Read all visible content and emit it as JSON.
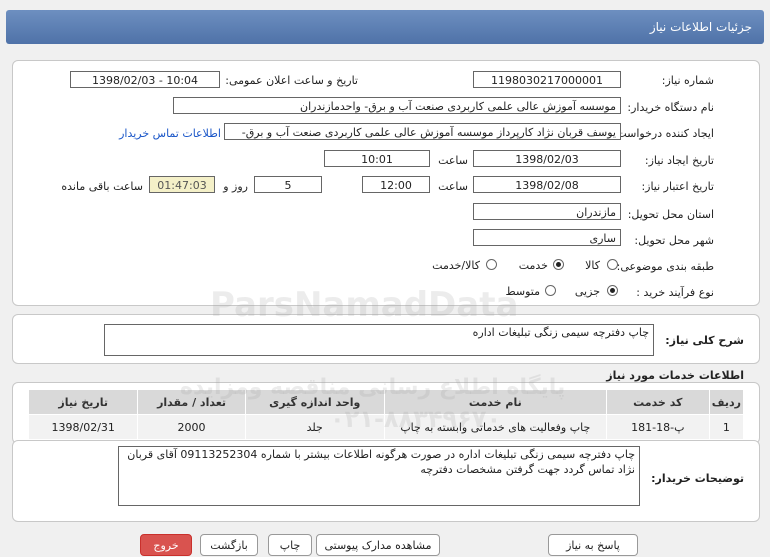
{
  "title": "جزئیات اطلاعات نیاز",
  "fields": {
    "need_number_label": "شماره نیاز:",
    "need_number": "1198030217000001",
    "announce_label": "تاریخ و ساعت اعلان عمومی:",
    "announce_value": "1398/02/03 - 10:04",
    "buyer_label": "نام دستگاه خریدار:",
    "buyer": "موسسه آموزش عالی علمی کاربردی صنعت آب و برق- واحدمازندران",
    "creator_label": "ایجاد کننده درخواست:",
    "creator": "یوسف قربان نژاد کارپرداز موسسه آموزش عالی علمی کاربردی صنعت آب و برق-",
    "contact_link": "اطلاعات تماس خریدار",
    "created_label": "تاریخ ایجاد نیاز:",
    "created_date": "1398/02/03",
    "time_label": "ساعت",
    "created_time": "10:01",
    "validity_label": "تاریخ اعتبار نیاز:",
    "validity_date": "1398/02/08",
    "validity_time": "12:00",
    "days": "5",
    "days_label": "روز و",
    "remaining": "01:47:03",
    "remaining_label": "ساعت باقی مانده",
    "province_label": "استان محل تحویل:",
    "province": "مازندران",
    "city_label": "شهر محل تحویل:",
    "city": "ساری",
    "category_label": "طبقه بندی موضوعی:",
    "cat_goods": "کالا",
    "cat_service": "خدمت",
    "cat_both": "کالا/خدمت",
    "process_label": "نوع فرآیند خرید :",
    "proc_partial": "جزیی",
    "proc_medium": "متوسط"
  },
  "summary": {
    "label": "شرح کلی نیاز:",
    "text": "چاپ دفترچه سیمی زنگی تبلیغات اداره"
  },
  "services": {
    "title": "اطلاعات خدمات مورد نیاز",
    "columns": [
      "ردیف",
      "کد خدمت",
      "نام خدمت",
      "واحد اندازه گیری",
      "تعداد / مقدار",
      "تاریخ نیاز"
    ],
    "rows": [
      [
        "1",
        "پ-18-181",
        "چاپ وفعالیت های خدماتی وابسته به چاپ",
        "جلد",
        "2000",
        "1398/02/31"
      ]
    ]
  },
  "buyer_notes": {
    "label": "توضیحات خریدار:",
    "text": "چاپ دفترچه سیمی زنگی تبلیغات اداره در صورت هرگونه اطلاعات بیشتر با شماره 09113252304 آقای قربان نژاد تماس گردد جهت گرفتن مشخصات دفترچه"
  },
  "buttons": {
    "reply": "پاسخ به نیاز",
    "view_docs": "مشاهده مدارک پیوستی",
    "print": "چاپ",
    "back": "بازگشت",
    "exit": "خروج"
  },
  "watermark": {
    "line1": "ParsNamadData",
    "line2": "پایگاه اطلاع رسانی مناقصه ومزایده",
    "line3": "۰۲۱-۸۸۳۴۹۶۷۰"
  }
}
